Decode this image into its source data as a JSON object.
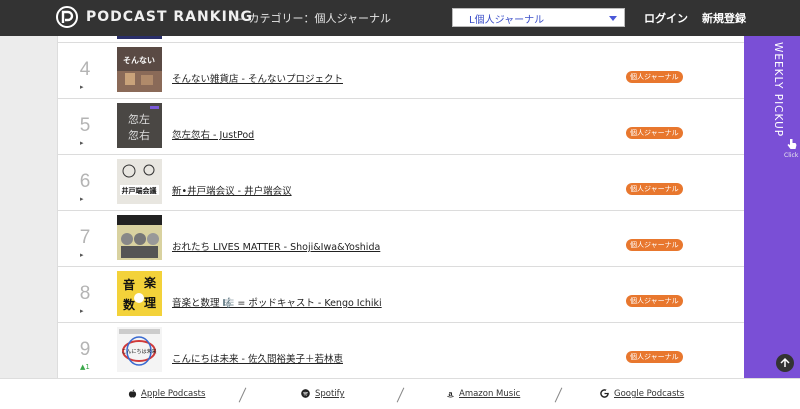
{
  "header": {
    "logo_text": "PODCAST RANKING",
    "category_label": "— カテゴリー：個人ジャーナル",
    "category_select_value": "L個人ジャーナル",
    "login": "ログイン",
    "register": "新規登録"
  },
  "rows": [
    {
      "rank": "4",
      "trend": "▸",
      "title": "そんない雑貨店 - そんないプロジェクト",
      "badge": "個人ジャーナル"
    },
    {
      "rank": "5",
      "trend": "▸",
      "title": "忽左忽右 - JustPod",
      "badge": "個人ジャーナル"
    },
    {
      "rank": "6",
      "trend": "▸",
      "title": "新•井戸端会议 - 井户端会议",
      "badge": "個人ジャーナル"
    },
    {
      "rank": "7",
      "trend": "▸",
      "title": "おれたち LIVES MATTER - Shoji&Iwa&Yoshida",
      "badge": "個人ジャーナル"
    },
    {
      "rank": "8",
      "trend": "▸",
      "title": "音楽と数理 🎼 = ポッドキャスト - Kengo Ichiki",
      "badge": "個人ジャーナル"
    },
    {
      "rank": "9",
      "trend": "▲1",
      "title": "こんにちは未来 - 佐久間裕美子＋若林恵",
      "badge": "個人ジャーナル"
    }
  ],
  "artwork_text": {
    "row4": "そんない",
    "row5_a": "忽左",
    "row5_b": "忽右",
    "row6": "井戸端会議",
    "row8_a": "音",
    "row8_b": "楽",
    "row8_c": "数",
    "row8_d": "理",
    "row9": "こんにちは未来"
  },
  "pickup": {
    "label": "WEEKLY PICKUP",
    "click": "Click",
    "color": "#7a4fd6"
  },
  "footer": {
    "apple": "Apple Podcasts",
    "spotify": "Spotify",
    "amazon": "Amazon Music",
    "google": "Google Podcasts"
  },
  "colors": {
    "header_bg": "#333333",
    "badge": "#e8772e",
    "select_text": "#3a4ec8"
  }
}
